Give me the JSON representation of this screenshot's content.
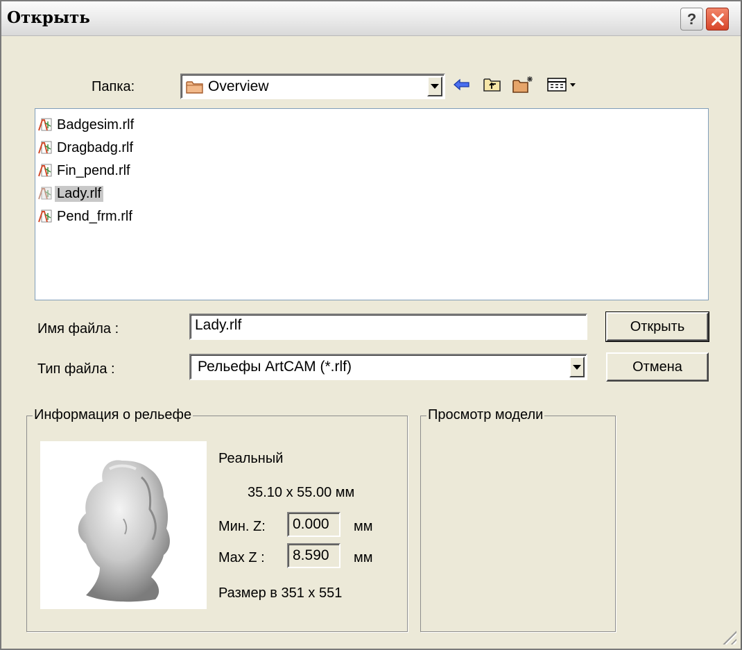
{
  "window": {
    "title": "Открыть"
  },
  "folder": {
    "label": "Папка:",
    "value": "Overview"
  },
  "toolbar": {
    "back_icon": "back-arrow-icon",
    "up_icon": "up-folder-icon",
    "new_folder_icon": "new-folder-icon",
    "view_menu_icon": "view-menu-icon"
  },
  "files": [
    {
      "name": "Badgesim.rlf",
      "selected": false
    },
    {
      "name": "Dragbadg.rlf",
      "selected": false
    },
    {
      "name": "Fin_pend.rlf",
      "selected": false
    },
    {
      "name": "Lady.rlf",
      "selected": true
    },
    {
      "name": "Pend_frm.rlf",
      "selected": false
    }
  ],
  "filename": {
    "label": "Имя файла :",
    "value": "Lady.rlf"
  },
  "filetype": {
    "label": "Тип файла :",
    "value": "Рельефы ArtCAM (*.rlf)"
  },
  "buttons": {
    "open": "Открыть",
    "cancel": "Отмена"
  },
  "relief_info": {
    "title": "Информация о рельефе",
    "type": "Реальный",
    "dimensions": "35.10 x 55.00 мм",
    "min_z_label": "Мин. Z:",
    "min_z": "0.000",
    "max_z_label": "Max Z :",
    "max_z": "8.590",
    "unit": "мм",
    "size": "Размер в 351 x 551"
  },
  "model_preview": {
    "title": "Просмотр модели"
  },
  "colors": {
    "dialog_bg": "#ece9d8",
    "selection": "#c8c8c8",
    "close_button": "#d7452a",
    "folder_icon": "#e8a06a",
    "back_arrow": "#2a4fd0"
  }
}
